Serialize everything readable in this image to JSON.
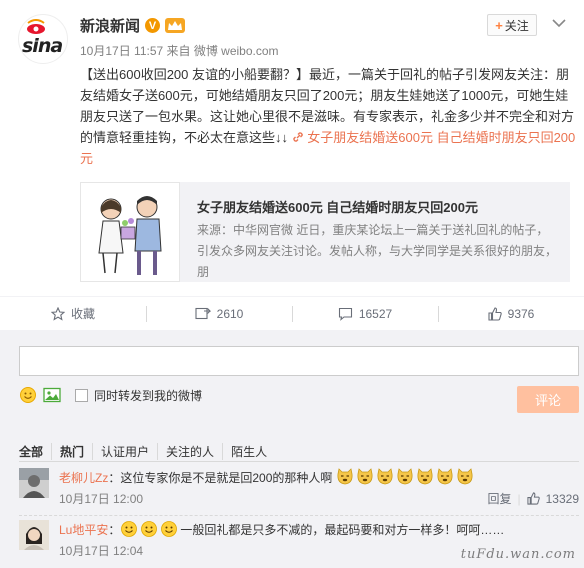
{
  "header": {
    "name": "新浪新闻",
    "meta": "10月17日 11:57 来自 微博 weibo.com",
    "follow_label": "关注",
    "logo_text": "sina",
    "v_badge": "V"
  },
  "post": {
    "text_prefix": "【送出600收回200 友谊的小船要翻？】最近，一篇关于回礼的帖子引发网友关注：朋友结婚女子送600元，可她结婚朋友只回了200元；朋友生娃她送了1000元，可她生娃朋友只送了一包水果。这让她心里很不是滋味。有专家表示，礼金多少并不完全和对方的情意轻重挂钩，不必太在意这些↓↓",
    "link_text": "女子朋友结婚送600元 自己结婚时朋友只回200元"
  },
  "card": {
    "title": "女子朋友结婚送600元 自己结婚时朋友只回200元",
    "desc": "来源：中华网官微 近日，重庆某论坛上一篇关于送礼回礼的帖子，引发众多网友关注讨论。发帖人称，与大学同学是关系很好的朋友，朋"
  },
  "actions": {
    "favorite_label": "收藏",
    "repost_count": "2610",
    "comment_count": "16527",
    "like_count": "9376"
  },
  "comment_form": {
    "also_repost_label": "同时转发到我的微博",
    "submit_label": "评论"
  },
  "filters": [
    "全部",
    "热门",
    "认证用户",
    "关注的人",
    "陌生人"
  ],
  "comments": [
    {
      "user": "老柳儿Zz",
      "text": "：这位专家你是不是就是回200的那种人啊",
      "time": "10月17日 12:00",
      "reply_label": "回复",
      "likes": "13329"
    },
    {
      "user": "Lu地平安",
      "text": "一般回礼都是只多不减的，最起码要和对方一样多！呵呵……",
      "time": "10月17日 12:04"
    }
  ],
  "watermark": "tuFdu.wan.com",
  "colors": {
    "link": "#eb7350",
    "submit_disabled": "#ffc09f",
    "panel": "#f2f2f5"
  }
}
